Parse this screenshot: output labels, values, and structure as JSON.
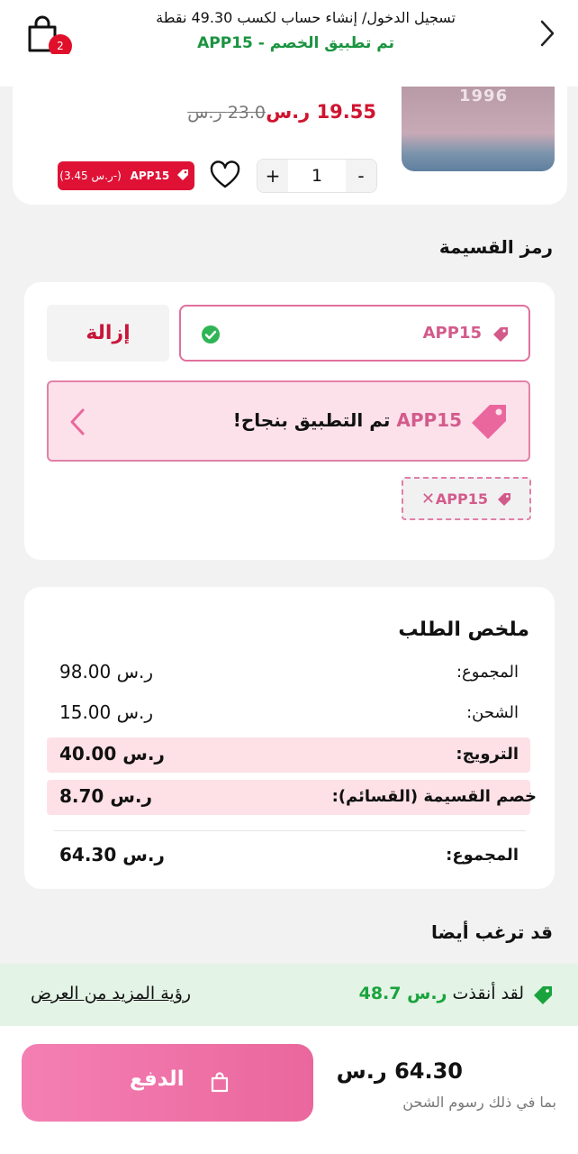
{
  "header": {
    "cart_count": "2",
    "login_text": "تسجيل الدخول/ إنشاء حساب لكسب 49.30 نقطة",
    "discount_applied": "تم تطبيق الخصم - APP15"
  },
  "product": {
    "image_text": "1996",
    "price_new": "19.55 ر.س",
    "price_old": "23.0 ر.س",
    "qty": "1",
    "qty_plus": "+",
    "qty_minus": "-",
    "coupon_code": "APP15",
    "coupon_discount": "(-ر.س 3.45)"
  },
  "coupon": {
    "section_title": "رمز القسيمة",
    "input_value": "APP15",
    "remove_label": "إزالة",
    "success_code": "APP15",
    "success_msg": "تم التطبيق بنجاح!",
    "applied_chip": "APP15",
    "applied_chip_close": "✕"
  },
  "summary": {
    "title": "ملخص الطلب",
    "rows": [
      {
        "label": "المجموع:",
        "value": "98.00 ر.س"
      },
      {
        "label": "الشحن:",
        "value": "15.00 ر.س"
      },
      {
        "label": "الترويج:",
        "value": "40.00 ر.س"
      },
      {
        "label": "خصم القسيمة (القسائم):",
        "value": "8.70 ر.س"
      },
      {
        "label": "المجموع:",
        "value": "64.30 ر.س"
      }
    ]
  },
  "also_like": {
    "title": "قد ترغب أيضا",
    "saved_prefix": "لقد أنقذت",
    "saved_amount": "ر.س 48.7",
    "see_more": "رؤية المزيد من العرض"
  },
  "checkout": {
    "pay_label": "الدفع",
    "total": "64.30 ر.س",
    "total_note": "بما في ذلك رسوم الشحن"
  },
  "colors": {
    "accent_pink": "#ea679d",
    "sale_red": "#d0132f",
    "success_green": "#1a9440"
  }
}
